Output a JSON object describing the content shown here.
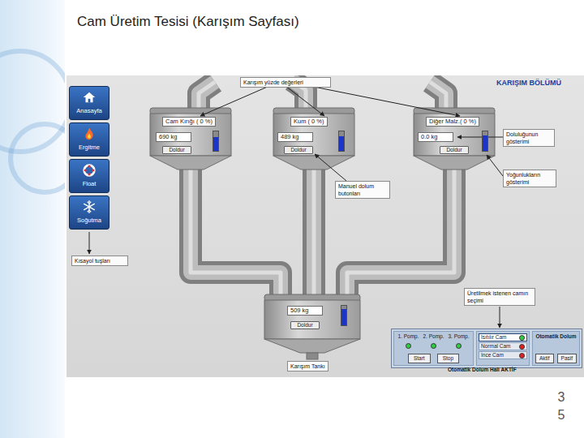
{
  "slide": {
    "title": "Cam Üretim Tesisi (Karışım Sayfası)",
    "page_number_lines": [
      "3",
      "5"
    ]
  },
  "screen": {
    "section_title": "KARIŞIM BÖLÜMÜ",
    "sidebar": {
      "items": [
        {
          "label": "Anasayfa"
        },
        {
          "label": "Ergitme"
        },
        {
          "label": "Float"
        },
        {
          "label": "Soğutma"
        }
      ]
    },
    "silos": [
      {
        "label": "Cam Kırığı ( 0 %)",
        "weight": "690 kg",
        "button": "Doldur",
        "level": 0.7
      },
      {
        "label": "Kum ( 0 %)",
        "weight": "489 kg",
        "button": "Doldur",
        "level": 0.75
      },
      {
        "label": "Diğer Malz.( 0 %)",
        "weight": "0.0 kg",
        "button": "Doldur",
        "level": 0.8
      }
    ],
    "tank": {
      "label": "Karışım Tankı",
      "weight": "509 kg",
      "button": "Doldur",
      "level": 0.85
    },
    "annotations": [
      {
        "text": "Karışım yüzde değerleri"
      },
      {
        "text": "Doluluğunun gösterimi"
      },
      {
        "text": "Yoğunlukların gösterimi"
      },
      {
        "text": "Manuel dolum butonları"
      },
      {
        "text": "Kısayol tuşları"
      },
      {
        "text": "Üretilmek istenen camın seçimi"
      }
    ],
    "pumps": [
      {
        "label": "1. Pomp.",
        "on": true
      },
      {
        "label": "2. Pomp.",
        "on": true
      },
      {
        "label": "3. Pomp.",
        "on": true
      }
    ],
    "pump_buttons": [
      "Start",
      "Stop"
    ],
    "glass_types": [
      {
        "label": "Isıtılır Cam",
        "selected": true,
        "color": "#2ecc40"
      },
      {
        "label": "Normal Cam",
        "selected": false,
        "color": "#e02020"
      },
      {
        "label": "İnce Cam",
        "selected": false,
        "color": "#e02020"
      }
    ],
    "auto_fill": {
      "title": "Otomatik Dolum",
      "buttons": [
        "Aktif",
        "Pasif"
      ],
      "status": "Otomatik Dolum Hali AKTİF"
    }
  }
}
